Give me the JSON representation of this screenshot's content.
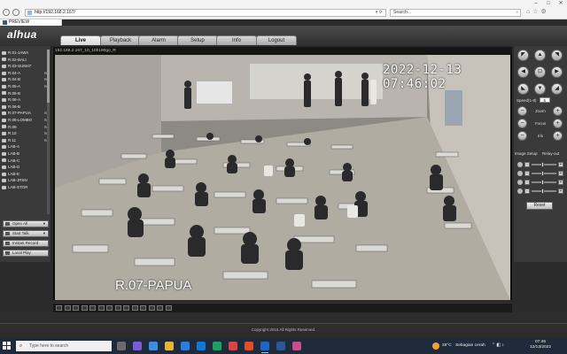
{
  "browser": {
    "url": "http://192.168.2.167/",
    "search_placeholder": "Search...",
    "tab_title": "PREVIEW"
  },
  "app": {
    "logo": "alhua",
    "nav_tabs": [
      "Live",
      "Playback",
      "Alarm",
      "Setup",
      "Info",
      "Logout"
    ],
    "active_tab": "Live"
  },
  "channels": [
    {
      "label": "R.01-JAWA",
      "mark": ""
    },
    {
      "label": "R.02-BALI",
      "mark": ""
    },
    {
      "label": "R.03-SUMAT",
      "mark": ""
    },
    {
      "label": "R.04-A",
      "mark": "M"
    },
    {
      "label": "R.04-B",
      "mark": "M"
    },
    {
      "label": "R.05-A",
      "mark": "M"
    },
    {
      "label": "R.05-B",
      "mark": ""
    },
    {
      "label": "R.06-A",
      "mark": ""
    },
    {
      "label": "R.06-B",
      "mark": ""
    },
    {
      "label": "R.07-PAPUA",
      "mark": "M"
    },
    {
      "label": "R.08-LOMBO",
      "mark": "M"
    },
    {
      "label": "R.09",
      "mark": "M"
    },
    {
      "label": "R.10",
      "mark": "M"
    },
    {
      "label": "R.11",
      "mark": "M"
    },
    {
      "label": "LAB-A",
      "mark": ""
    },
    {
      "label": "LAB-B",
      "mark": ""
    },
    {
      "label": "LAB-C",
      "mark": ""
    },
    {
      "label": "LAB-D",
      "mark": ""
    },
    {
      "label": "LAB-E",
      "mark": ""
    },
    {
      "label": "LAB-JRSN",
      "mark": ""
    },
    {
      "label": "LAB-STOR",
      "mark": ""
    }
  ],
  "left_buttons": {
    "open_all": "Open All",
    "start_talk": "Start Talk",
    "instant_record": "Instant Record",
    "local_play": "Local Play"
  },
  "video": {
    "title": "192.168.2.167_10_10h180go_R",
    "timestamp": "2022-12-13  07:46:02",
    "camera_label": "R.07-PAPUA"
  },
  "ptz": {
    "speed_label": "Speed(1-8)",
    "speed_value": "5",
    "zoom_label": "Zoom",
    "focus_label": "Focus",
    "iris_label": "Iris",
    "image_setup_label": "Image Setup",
    "relay_out_label": "Relay-out",
    "reset_label": "Reset",
    "slider_levels": [
      0.45,
      0.45,
      0.45,
      0.45
    ]
  },
  "footer": {
    "copyright": "Copyright 2015.All Rights Reserved."
  },
  "taskbar": {
    "search_placeholder": "Type here to search",
    "weather_temp": "28°C",
    "weather_text": "Sebagian cerah",
    "time": "07:46",
    "date": "12/13/2022"
  },
  "colors": {
    "app_bg": "#3a3a3a",
    "taskbar_bg": "#1f2b3a"
  }
}
